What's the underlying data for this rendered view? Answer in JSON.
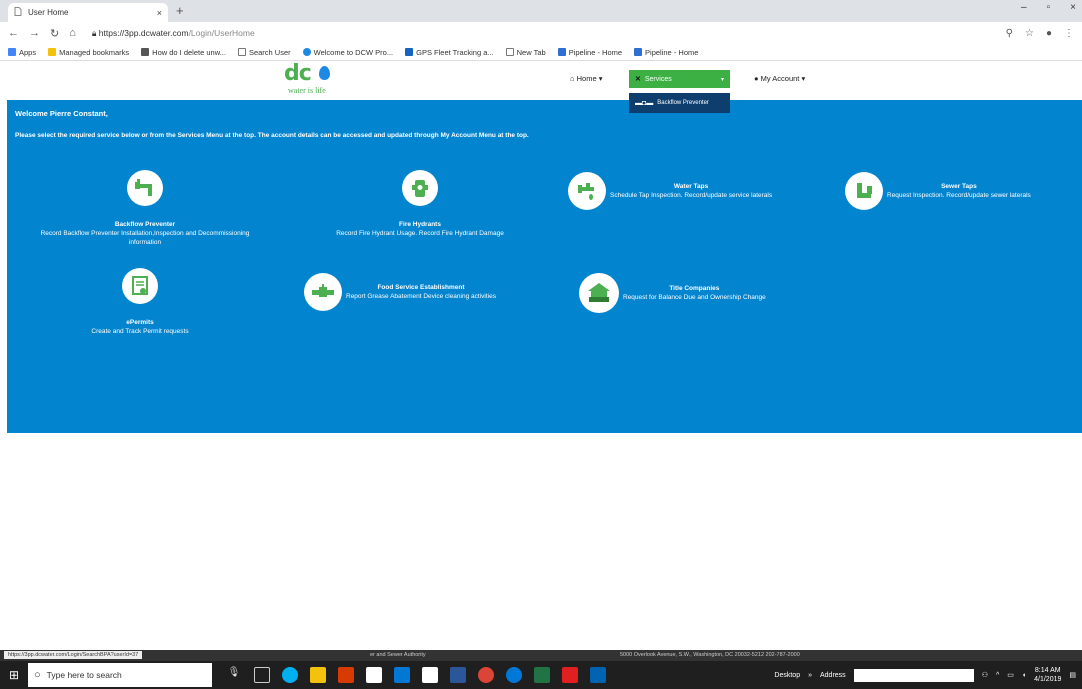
{
  "browser": {
    "tab_title": "User Home",
    "tab_close": "×",
    "new_tab": "+",
    "url_host": "https://3pp.dcwater.com",
    "url_path": "/Login/UserHome",
    "window_controls": {
      "minimize": "–",
      "restore": "▫",
      "close": "×"
    },
    "bookmarks": [
      "Apps",
      "Managed bookmarks",
      "How do I delete unw...",
      "Search User",
      "Welcome to DCW Pro...",
      "GPS Fleet Tracking a...",
      "New Tab",
      "Pipeline - Home",
      "Pipeline - Home"
    ]
  },
  "header": {
    "logo_text": "dc",
    "logo_tagline": "water is life",
    "nav_home": "Home",
    "nav_services": "Services",
    "nav_account": "My Account",
    "services_dropdown_item": "Backflow Preventer"
  },
  "main": {
    "welcome": "Welcome Pierre Constant,",
    "instructions": "Please select the required service below or from the Services Menu at the top. The account details can be accessed and updated through My Account Menu at the top.",
    "services": {
      "backflow": {
        "name": "Backflow Preventer",
        "desc": "Record Backflow Preventer Installation,Inspection and Decommissioning information"
      },
      "hydrants": {
        "name": "Fire Hydrants",
        "desc": "Record Fire Hydrant Usage. Record Fire Hydrant Damage"
      },
      "water_taps": {
        "name": "Water Taps",
        "desc": "Schedule Tap Inspection. Record/update service laterals"
      },
      "sewer_taps": {
        "name": "Sewer Taps",
        "desc": "Request Inspection. Record/update sewer laterals"
      },
      "epermits": {
        "name": "ePermits",
        "desc": "Create and Track Permit requests"
      },
      "food": {
        "name": "Food Service Establishment",
        "desc": "Report Grease Abatement Device cleaning activities"
      },
      "title": {
        "name": "Title Companies",
        "desc": "Request for Balance Due and Ownership Change"
      }
    }
  },
  "footer": {
    "status_url": "https://3pp.dcwater.com/Login/SearchBPA?userId=37",
    "authority": "er and Sewer Authority",
    "address": "5000 Overlook Avenue, S.W., Washington, DC 20032-5212 202-787-2000"
  },
  "taskbar": {
    "search_placeholder": "Type here to search",
    "desktop": "Desktop",
    "address_label": "Address",
    "time": "8:14 AM",
    "date": "4/1/2019"
  },
  "colors": {
    "panel_blue": "#0284ce",
    "services_green": "#3cb043",
    "dropdown_navy": "#0d3e6e",
    "logo_green": "#4caf50"
  }
}
